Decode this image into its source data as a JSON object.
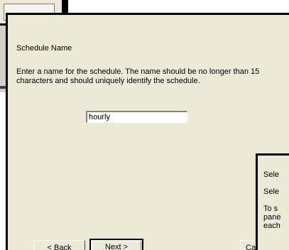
{
  "wizard": {
    "heading": "Schedule Name",
    "description": "Enter a name for the schedule. The name should be no longer than 15 characters and should uniquely identify the schedule.",
    "name_input": {
      "value": "hourly"
    },
    "buttons": {
      "back": "< Back",
      "next": "Next >",
      "cancel": "Ca"
    }
  },
  "second_dialog": {
    "line1": "Sele",
    "line2": "Sele",
    "line3": "To s",
    "line4": "pane",
    "line5": "each"
  }
}
